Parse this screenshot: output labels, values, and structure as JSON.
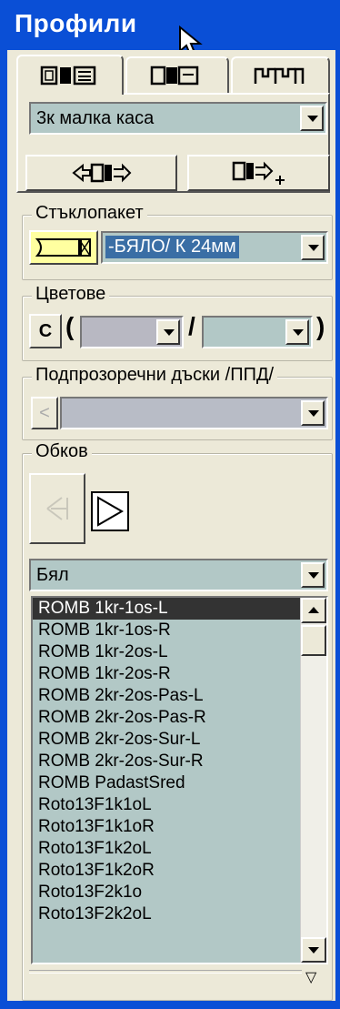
{
  "window": {
    "title": "Профили"
  },
  "profile_tabs": [
    {
      "icon": "profile-frame-icon"
    },
    {
      "icon": "profile-sash-icon"
    },
    {
      "icon": "profile-set-icon"
    }
  ],
  "profile_combo": {
    "value": "3к малка каса"
  },
  "glass": {
    "legend": "Стъклопакет",
    "value": "-БЯЛО/ К 24мм"
  },
  "colors": {
    "legend": "Цветове",
    "c_label": "C",
    "open_paren": "(",
    "slash": "/",
    "close_paren": ")"
  },
  "sill": {
    "legend": "Подпрозоречни дъски /ППД/",
    "left_btn": "<"
  },
  "hardware": {
    "legend": "Обков",
    "color_value": "Бял",
    "items": [
      "ROMB 1kr-1os-L",
      "ROMB 1kr-1os-R",
      "ROMB 1kr-2os-L",
      "ROMB 1kr-2os-R",
      "ROMB 2kr-2os-Pas-L",
      "ROMB 2kr-2os-Pas-R",
      "ROMB 2kr-2os-Sur-L",
      "ROMB 2kr-2os-Sur-R",
      "ROMB PadastSred",
      "Roto13F1k1oL",
      "Roto13F1k1oR",
      "Roto13F1k2oL",
      "Roto13F1k2oR",
      "Roto13F2k1o",
      "Roto13F2k2oL"
    ],
    "selected_index": 0
  },
  "footer": {
    "arrow": "▽"
  },
  "colors_theme": {
    "titlebar": "#0a4fd6",
    "field": "#b2c8c6",
    "face": "#ece9d8",
    "highlight": "#3a6ea5",
    "swatch": "#ffffa0"
  }
}
